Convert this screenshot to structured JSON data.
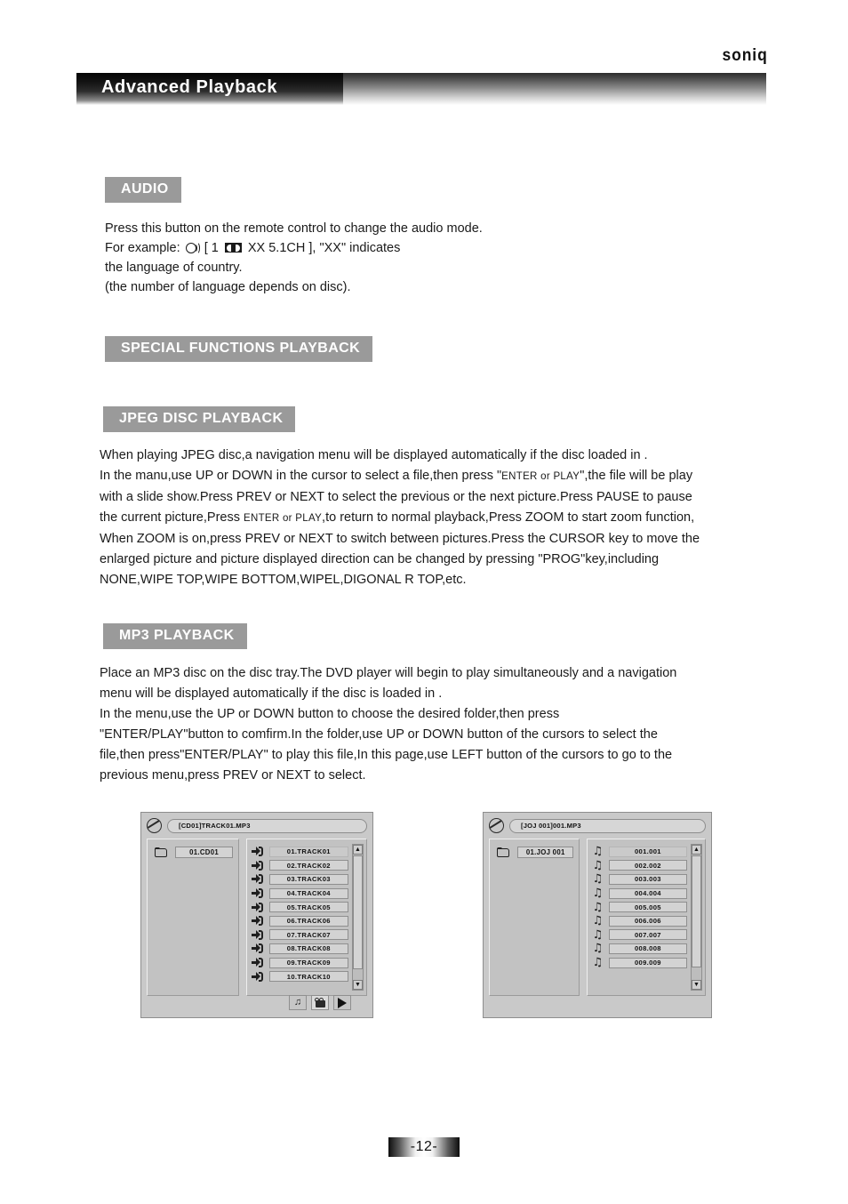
{
  "brand": "soniq",
  "header": {
    "title": "Advanced Playback"
  },
  "sections": {
    "audio": {
      "chip": "AUDIO",
      "line1": "Press this button on the remote control to change the audio mode.",
      "example_prefix": "For example:",
      "example_mid": "[ 1",
      "example_post": "XX 5.1CH ], \"XX\" indicates",
      "line3": "the language of country.",
      "line4": "(the number of language depends on disc)."
    },
    "special": {
      "chip": "SPECIAL FUNCTIONS PLAYBACK"
    },
    "jpeg": {
      "chip": "JPEG DISC PLAYBACK",
      "l1": "When playing JPEG disc,a navigation menu will be displayed   automatically if the disc loaded in .",
      "l2a": "In the manu,use UP or DOWN in the cursor to select a file,then press \"",
      "l2b": "ENTER or PLAY",
      "l2c": "\",the file will be play",
      "l3": "with a slide show.Press PREV or NEXT to select the previous or the next picture.Press PAUSE to pause",
      "l4a": "the current picture,Press",
      "l4b": "ENTER or PLAY",
      "l4c": ",to return to normal playback,Press ZOOM to start zoom function,",
      "l5": "When ZOOM is on,press PREV or NEXT to switch between pictures.Press the CURSOR key to move the",
      "l6": "enlarged picture and picture displayed direction can be changed by pressing \"PROG\"key,including",
      "l7": "NONE,WIPE TOP,WIPE BOTTOM,WIPEL,DIGONAL R TOP,etc."
    },
    "mp3": {
      "chip": "MP3 PLAYBACK",
      "l1": "Place an MP3 disc on the disc tray.The DVD player will begin to play simultaneously and a navigation",
      "l2": "menu will be displayed automatically if the disc is loaded in .",
      "l3": "In the menu,use the UP or DOWN button  to choose the desired folder,then press",
      "l4": "\"ENTER/PLAY\"button to comfirm.In the folder,use UP or DOWN button of the cursors to select the",
      "l5": "file,then press\"ENTER/PLAY\" to play this file,In this page,use LEFT button of the cursors to go to the",
      "l6": "previous menu,press PREV or NEXT  to select."
    }
  },
  "osd_left": {
    "path": "[CD01]TRACK01.MP3",
    "folder": "01.CD01",
    "files": [
      "01.TRACK01",
      "02.TRACK02",
      "03.TRACK03",
      "04.TRACK04",
      "05.TRACK05",
      "06.TRACK06",
      "07.TRACK07",
      "08.TRACK08",
      "09.TRACK09",
      "10.TRACK10"
    ],
    "selected_index": 0,
    "scroll_up": "▲",
    "scroll_down": "▼",
    "toolbar": {
      "music_icon": "♫",
      "slideshow_icon": "camera-icon",
      "play_icon": "play-icon"
    }
  },
  "osd_right": {
    "path": "[JOJ 001]001.MP3",
    "folder": "01.JOJ 001",
    "files": [
      "001.001",
      "002.002",
      "003.003",
      "004.004",
      "005.005",
      "006.006",
      "007.007",
      "008.008",
      "009.009"
    ],
    "selected_index": 0,
    "note_icon": "♫",
    "scroll_up": "▲",
    "scroll_down": "▼"
  },
  "footer": {
    "page": "-12-"
  },
  "colors": {
    "chip_bg": "#9a9a9a",
    "osd_bg": "#c9c9c9",
    "text": "#1a1a1a"
  }
}
